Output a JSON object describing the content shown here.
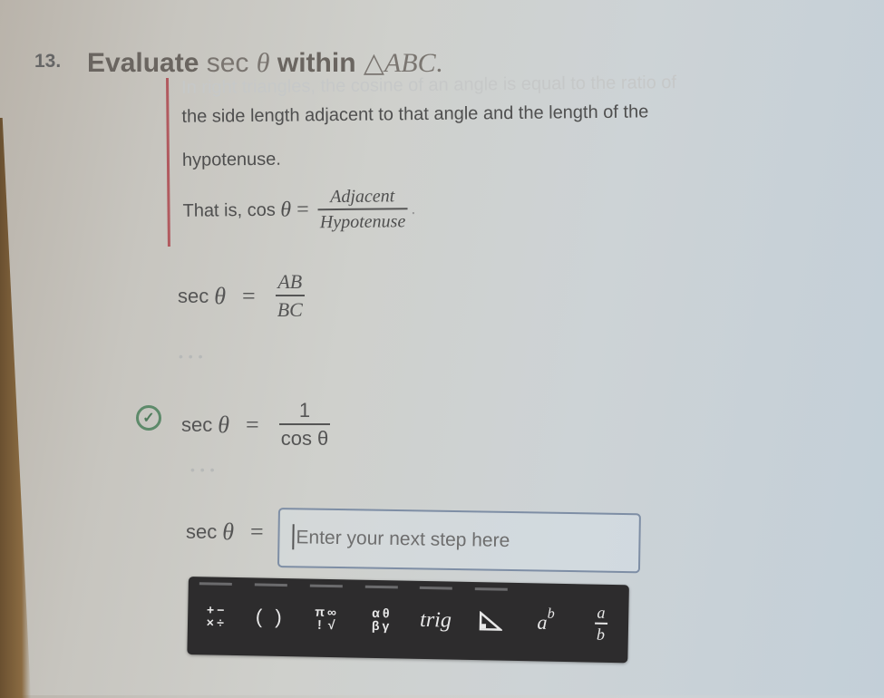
{
  "problem": {
    "number": "13.",
    "title_prefix": "Evaluate",
    "title_func": "sec",
    "title_var": "θ",
    "title_mid": "within",
    "title_triangle": "△",
    "title_triangle_name": "ABC",
    "title_end": "."
  },
  "hint": {
    "line1": "In right triangles, the cosine of an angle is equal to the ratio of",
    "line2": "the side length adjacent to that angle and the length of the",
    "line3": "hypotenuse.",
    "that_is": "That is,",
    "cos": "cos",
    "theta": "θ",
    "equals": "=",
    "numerator": "Adjacent",
    "denominator": "Hypotenuse",
    "period": "."
  },
  "steps": [
    {
      "lhs": "sec",
      "theta": "θ",
      "eq": "=",
      "numerator": "AB",
      "denominator": "BC",
      "status": ""
    },
    {
      "lhs": "sec",
      "theta": "θ",
      "eq": "=",
      "numerator": "1",
      "denominator": "cos θ",
      "status": "correct"
    }
  ],
  "ellipsis": "• • •",
  "answer": {
    "lhs": "sec",
    "theta": "θ",
    "eq": "=",
    "placeholder": "Enter your next step here",
    "value": ""
  },
  "colors": {
    "hint_border": "#b15a5f",
    "check": "#5d8a6a",
    "toolbar_bg": "#2d2c2d",
    "input_border": "#7e8ea5"
  },
  "toolbar": {
    "operators": [
      "+",
      "−",
      "×",
      "÷"
    ],
    "parens": "( )",
    "constants": [
      "π",
      "∞",
      "!",
      "√"
    ],
    "greek": [
      "α",
      "θ",
      "β",
      "γ"
    ],
    "trig": "trig",
    "triangle_icon": "right-triangle-icon",
    "power_base": "a",
    "power_exp": "b",
    "fraction_num": "a",
    "fraction_den": "b"
  }
}
